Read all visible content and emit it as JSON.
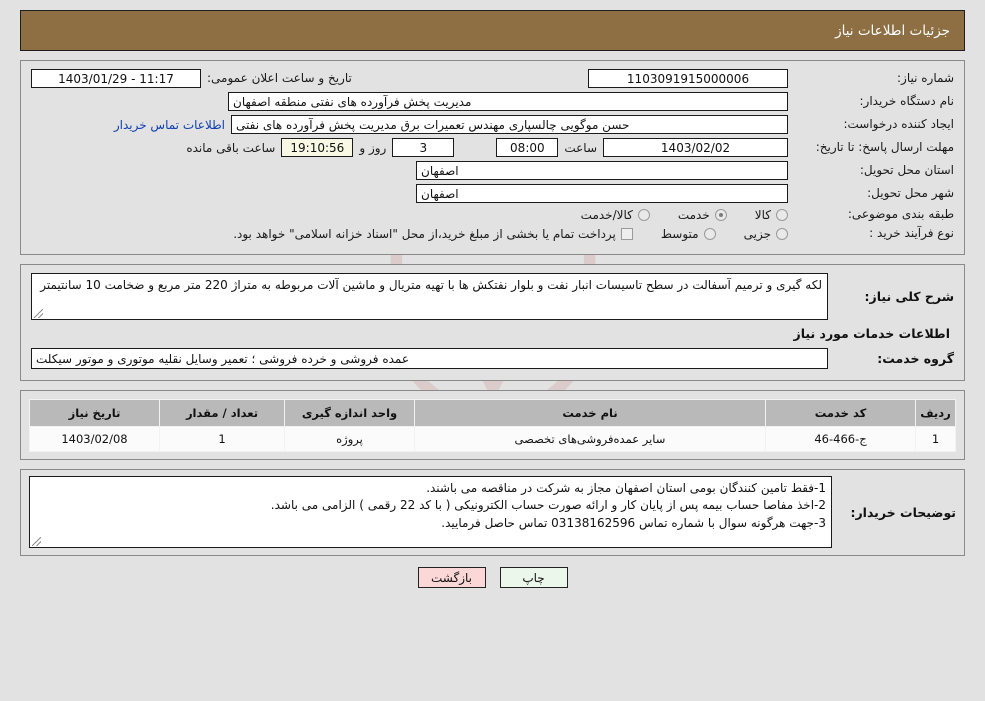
{
  "header": {
    "title": "جزئیات اطلاعات نیاز"
  },
  "colors": {
    "header_bg": "#8d6f43",
    "page_bg": "#e2e2e2",
    "field_bg": "#ffffff",
    "highlight_bg": "#f8f8e4",
    "link": "#1040b0",
    "table_header_bg": "#b9b9b9",
    "print_btn_bg": "#eaf7ea",
    "back_btn_bg": "#fbd7d7"
  },
  "watermark": {
    "text": "AriaTender.net"
  },
  "form": {
    "need_number_label": "شماره نیاز:",
    "need_number_value": "1103091915000006",
    "public_announce_label": "تاریخ و ساعت اعلان عمومی:",
    "public_announce_value": "11:17 - 1403/01/29",
    "buyer_org_label": "نام دستگاه خریدار:",
    "buyer_org_value": "مدیریت پخش فرآورده های نفتی منطقه اصفهان",
    "requester_label": "ایجاد کننده درخواست:",
    "requester_value": "حسن موگویی چالسپاری مهندس تعمیرات برق مدیریت پخش فرآورده های نفتی",
    "buyer_contact_link": "اطلاعات تماس خریدار",
    "deadline_label": "مهلت ارسال پاسخ: تا تاریخ:",
    "deadline_date": "1403/02/02",
    "hour_label": "ساعت",
    "deadline_time": "08:00",
    "days_value": "3",
    "days_label": "روز و",
    "countdown_value": "19:10:56",
    "countdown_label": "ساعت باقی مانده",
    "province_label": "استان محل تحویل:",
    "province_value": "اصفهان",
    "city_label": "شهر محل تحویل:",
    "city_value": "اصفهان",
    "category_label": "طبقه بندی موضوعی:",
    "category_options": [
      {
        "label": "کالا",
        "selected": false
      },
      {
        "label": "خدمت",
        "selected": true
      },
      {
        "label": "کالا/خدمت",
        "selected": false
      }
    ],
    "process_label": "نوع فرآیند خرید :",
    "process_options": [
      {
        "label": "جزیی",
        "selected": false
      },
      {
        "label": "متوسط",
        "selected": false
      }
    ],
    "treasury_checkbox_text": "پرداخت تمام یا بخشی از مبلغ خرید،از محل \"اسناد خزانه اسلامی\" خواهد بود."
  },
  "description": {
    "label": "شرح کلی نیاز:",
    "text": "لکه گیری و ترمیم آسفالت در سطح تاسیسات انبار نفت و بلوار نفتکش ها با تهیه متریال و ماشین آلات مربوطه به متراژ 220 متر مربع و ضخامت 10 سانتیمتر"
  },
  "services": {
    "section_title": "اطلاعات خدمات مورد نیاز",
    "group_label": "گروه خدمت:",
    "group_value": "عمده فروشی و خرده فروشی ؛ تعمیر وسایل نقلیه موتوری و موتور سیکلت",
    "columns": [
      "ردیف",
      "کد خدمت",
      "نام خدمت",
      "واحد اندازه گیری",
      "تعداد / مقدار",
      "تاریخ نیاز"
    ],
    "rows": [
      {
        "row_no": "1",
        "service_code": "ج-466-46",
        "service_name": "سایر عمده‌فروشی‌های تخصصی",
        "unit": "پروژه",
        "quantity": "1",
        "need_date": "1403/02/08"
      }
    ]
  },
  "buyer_notes": {
    "label": "توضیحات خریدار:",
    "text": "1-فقط تامین کنندگان بومی استان اصفهان مجاز به شرکت در مناقصه می باشند.\n2-اخذ مفاصا حساب بیمه پس از پایان کار و ارائه صورت حساب الکترونیکی ( با کد 22 رقمی ) الزامی می باشد.\n3-جهت هرگونه سوال با شماره تماس 03138162596 تماس حاصل فرمایید."
  },
  "footer": {
    "print_label": "چاپ",
    "back_label": "بازگشت"
  }
}
